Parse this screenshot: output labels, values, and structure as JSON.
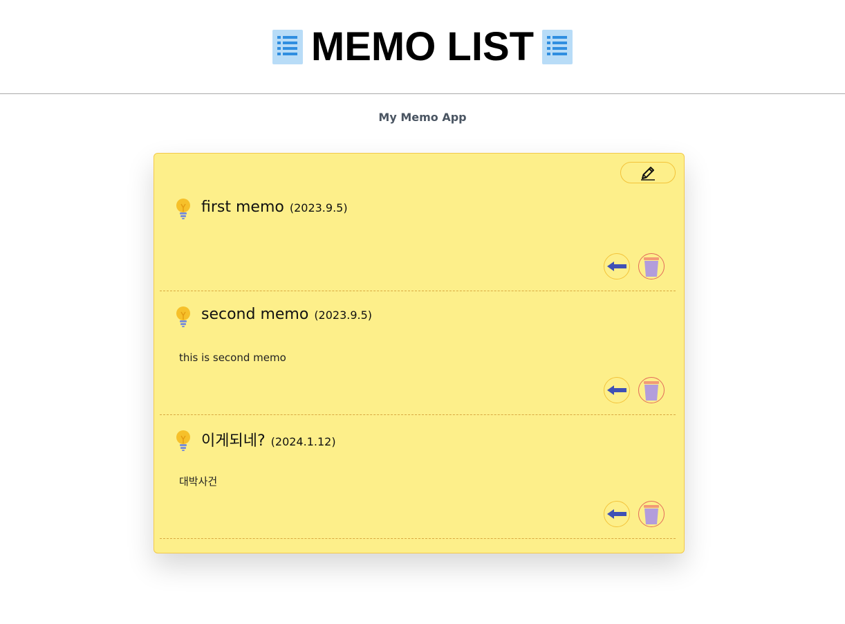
{
  "header": {
    "title": "MEMO LIST",
    "left_icon": "list-icon",
    "right_icon": "list-icon"
  },
  "subtitle": "My Memo App",
  "toolbar": {
    "write_icon": "pencil-icon"
  },
  "memos": [
    {
      "title": "first memo",
      "date": "(2023.9.5)",
      "body": ""
    },
    {
      "title": "second memo",
      "date": "(2023.9.5)",
      "body": "this is second memo"
    },
    {
      "title": "이게되네?",
      "date": "(2024.1.12)",
      "body": "대박사건"
    }
  ],
  "colors": {
    "panel_bg": "#fdef8a",
    "panel_border": "#f3c94a",
    "arrow": "#3f51b5",
    "trash": "#b39ddb"
  }
}
